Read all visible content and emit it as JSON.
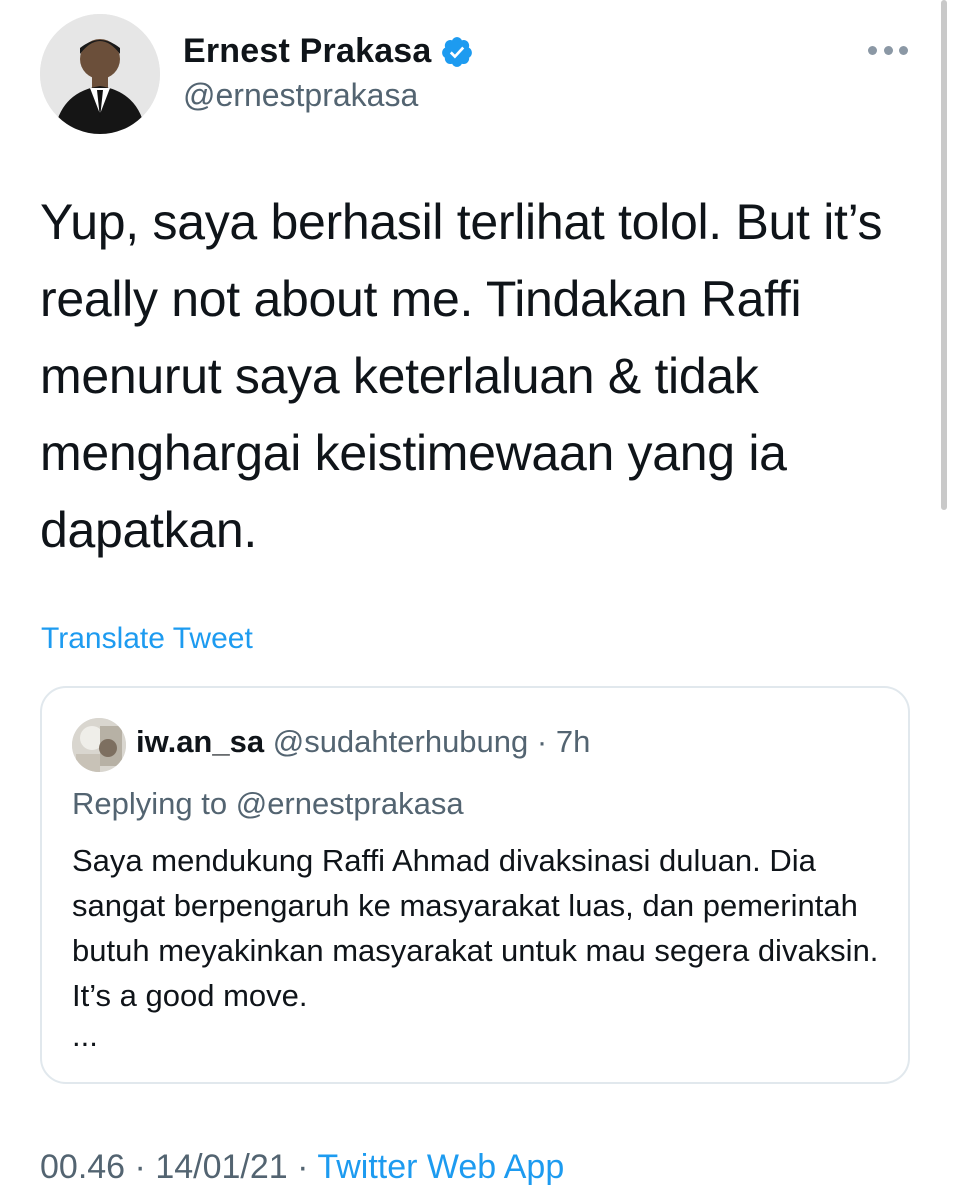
{
  "tweet": {
    "author_name": "Ernest Prakasa",
    "author_handle": "@ernestprakasa",
    "text": "Yup, saya berhasil terlihat tolol. But it’s really not about me. Tindakan Raffi menurut saya keterlaluan & tidak menghargai keistimewaan yang ia dapatkan.",
    "translate_label": "Translate Tweet",
    "time": "00.46",
    "date": "14/01/21",
    "separator": "·",
    "source": "Twitter Web App"
  },
  "quoted_tweet": {
    "author_name": "iw.an_sa",
    "author_handle": "@sudahterhubung",
    "separator": "·",
    "age": "7h",
    "reply_prefix": "Replying to",
    "reply_to": "@ernestprakasa",
    "text": "Saya mendukung Raffi Ahmad divaksinasi duluan. Dia sangat berpengaruh ke masyarakat luas, dan pemerintah butuh meyakinkan masyarakat untuk mau segera divaksin. It’s a good move.",
    "truncation": "..."
  },
  "icons": {
    "verified": "verified-badge-icon",
    "more": "more-options-icon"
  },
  "colors": {
    "accent": "#1d9bf0",
    "secondary_text": "#536471",
    "primary_text": "#0f1419",
    "border": "#e1e8ed"
  }
}
